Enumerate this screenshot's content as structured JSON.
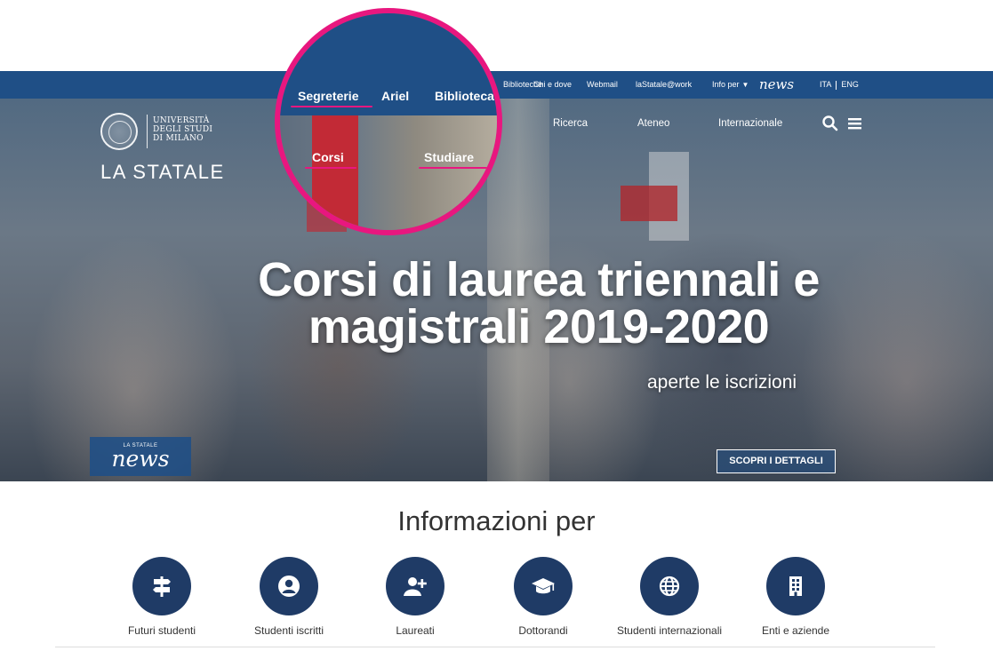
{
  "topbar": {
    "items": [
      "Segreterie",
      "Ariel",
      "Biblioteche",
      "Chi e dove",
      "Webmail",
      "laStatale@work",
      "Info per"
    ],
    "news": "news",
    "lang_it": "ITA",
    "lang_en": "ENG"
  },
  "logo": {
    "university": "UNIVERSITÀ\nDEGLI STUDI\nDI MILANO",
    "name": "LA STATALE"
  },
  "mainnav": {
    "items": [
      "Corsi",
      "Studiare",
      "Ricerca",
      "Ateneo",
      "Internazionale"
    ]
  },
  "hero": {
    "title": "Corsi di laurea triennali e magistrali 2019-2020",
    "subtitle": "aperte le iscrizioni",
    "news_kicker": "LA STATALE",
    "news_word": "news",
    "cta": "SCOPRI I DETTAGLI"
  },
  "magnifier": {
    "top_items": [
      "Segreterie",
      "Ariel",
      "Biblioteca"
    ],
    "nav_items": [
      "Corsi",
      "Studiare"
    ],
    "highlight_color": "#e8177f"
  },
  "info": {
    "title": "Informazioni per",
    "audiences": [
      {
        "label": "Futuri studenti",
        "icon": "signpost-icon"
      },
      {
        "label": "Studenti iscritti",
        "icon": "user-icon"
      },
      {
        "label": "Laureati",
        "icon": "add-user-icon"
      },
      {
        "label": "Dottorandi",
        "icon": "graduation-cap-icon"
      },
      {
        "label": "Studenti internazionali",
        "icon": "globe-icon"
      },
      {
        "label": "Enti e aziende",
        "icon": "building-icon"
      }
    ]
  },
  "colors": {
    "brand_blue": "#1f4f86",
    "dark_blue": "#1f3b66",
    "accent_pink": "#e8177f"
  }
}
